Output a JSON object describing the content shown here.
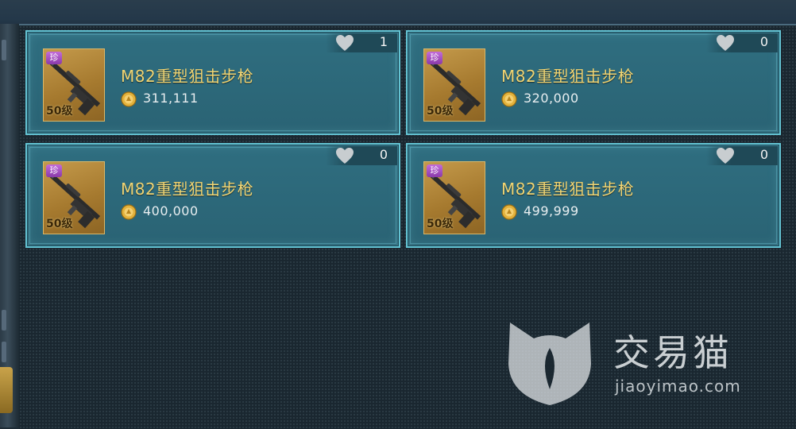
{
  "listings": [
    {
      "rarity_badge": "珍",
      "level": "50级",
      "name": "M82重型狙击步枪",
      "price": "311,111",
      "likes": "1"
    },
    {
      "rarity_badge": "珍",
      "level": "50级",
      "name": "M82重型狙击步枪",
      "price": "320,000",
      "likes": "0"
    },
    {
      "rarity_badge": "珍",
      "level": "50级",
      "name": "M82重型狙击步枪",
      "price": "400,000",
      "likes": "0"
    },
    {
      "rarity_badge": "珍",
      "level": "50级",
      "name": "M82重型狙击步枪",
      "price": "499,999",
      "likes": "0"
    }
  ],
  "watermark": {
    "brand": "交易猫",
    "domain": "jiaoyimao.com"
  },
  "icons": {
    "heart": "heart-icon",
    "coin": "gold-coin-icon",
    "weapon": "sniper-rifle-icon",
    "logo": "cat-logo-icon"
  },
  "colors": {
    "card_bg": "#2f6e80",
    "card_border": "#64c4d4",
    "name_text": "#f1d472",
    "badge": "#a64cc4"
  }
}
